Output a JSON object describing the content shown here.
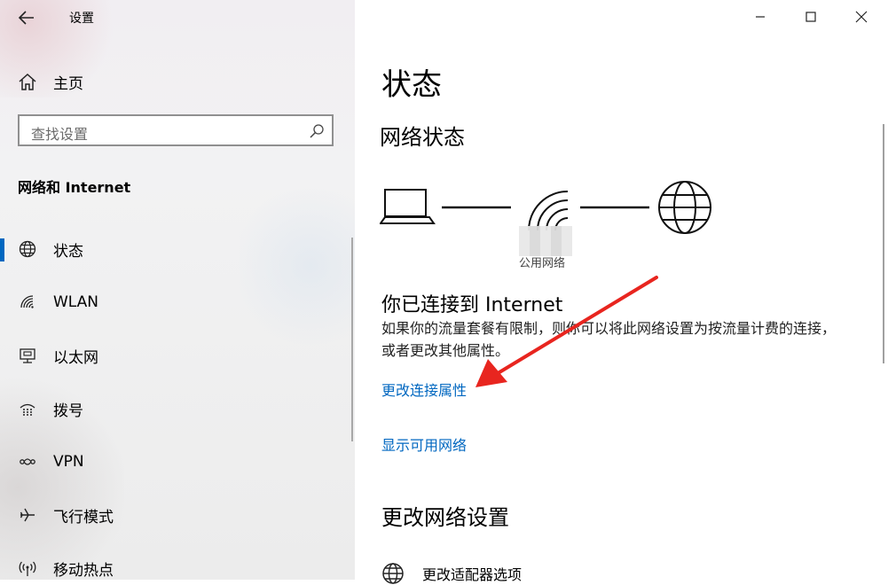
{
  "window": {
    "title": "设置"
  },
  "sidebar": {
    "home_label": "主页",
    "search_placeholder": "查找设置",
    "section_title": "网络和 Internet",
    "items": [
      {
        "label": "状态",
        "icon": "globe-icon",
        "selected": true
      },
      {
        "label": "WLAN",
        "icon": "wifi-icon"
      },
      {
        "label": "以太网",
        "icon": "ethernet-icon"
      },
      {
        "label": "拨号",
        "icon": "dialup-icon"
      },
      {
        "label": "VPN",
        "icon": "vpn-icon"
      },
      {
        "label": "飞行模式",
        "icon": "airplane-icon"
      },
      {
        "label": "移动热点",
        "icon": "hotspot-icon"
      }
    ]
  },
  "main": {
    "page_title": "状态",
    "network_status_title": "网络状态",
    "network_name": "公用网络",
    "connected_text": "你已连接到 Internet",
    "description": "如果你的流量套餐有限制，则你可以将此网络设置为按流量计费的连接，或者更改其他属性。",
    "link_change_properties": "更改连接属性",
    "link_show_networks": "显示可用网络",
    "change_settings_title": "更改网络设置",
    "adapter_options_label": "更改适配器选项"
  },
  "colors": {
    "accent": "#0067c0",
    "annotation_arrow": "#e8251f"
  }
}
